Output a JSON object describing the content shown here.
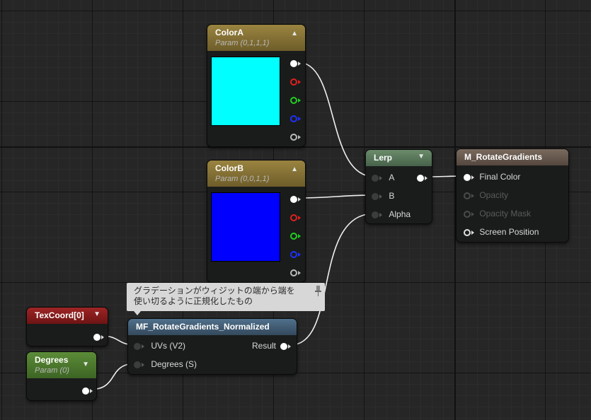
{
  "colors": {
    "colorA_swatch": "#00ffff",
    "colorB_swatch": "#0000ff",
    "param_header": "#8a7433",
    "lerp_header": "#5a7a5a",
    "result_header": "#6b5a4e",
    "texcoord_header": "#8a1c1c",
    "degrees_header": "#4e7a2f",
    "function_header": "#3f5a73"
  },
  "nodes": {
    "colorA": {
      "title": "ColorA",
      "subtitle": "Param (0,1,1,1)"
    },
    "colorB": {
      "title": "ColorB",
      "subtitle": "Param (0,0,1,1)"
    },
    "lerp": {
      "title": "Lerp",
      "pins": {
        "a": "A",
        "b": "B",
        "alpha": "Alpha"
      }
    },
    "result": {
      "title": "M_RotateGradients",
      "pins": {
        "final_color": "Final Color",
        "opacity": "Opacity",
        "opacity_mask": "Opacity Mask",
        "screen_position": "Screen Position"
      }
    },
    "texcoord": {
      "title": "TexCoord[0]"
    },
    "degrees": {
      "title": "Degrees",
      "subtitle": "Param (0)"
    },
    "func": {
      "title": "MF_RotateGradients_Normalized",
      "pins": {
        "uvs": "UVs (V2)",
        "degrees": "Degrees (S)",
        "result": "Result"
      }
    }
  },
  "comment": {
    "line1": "グラデーションがウィジットの端から端を",
    "line2": "使い切るように正規化したもの"
  }
}
